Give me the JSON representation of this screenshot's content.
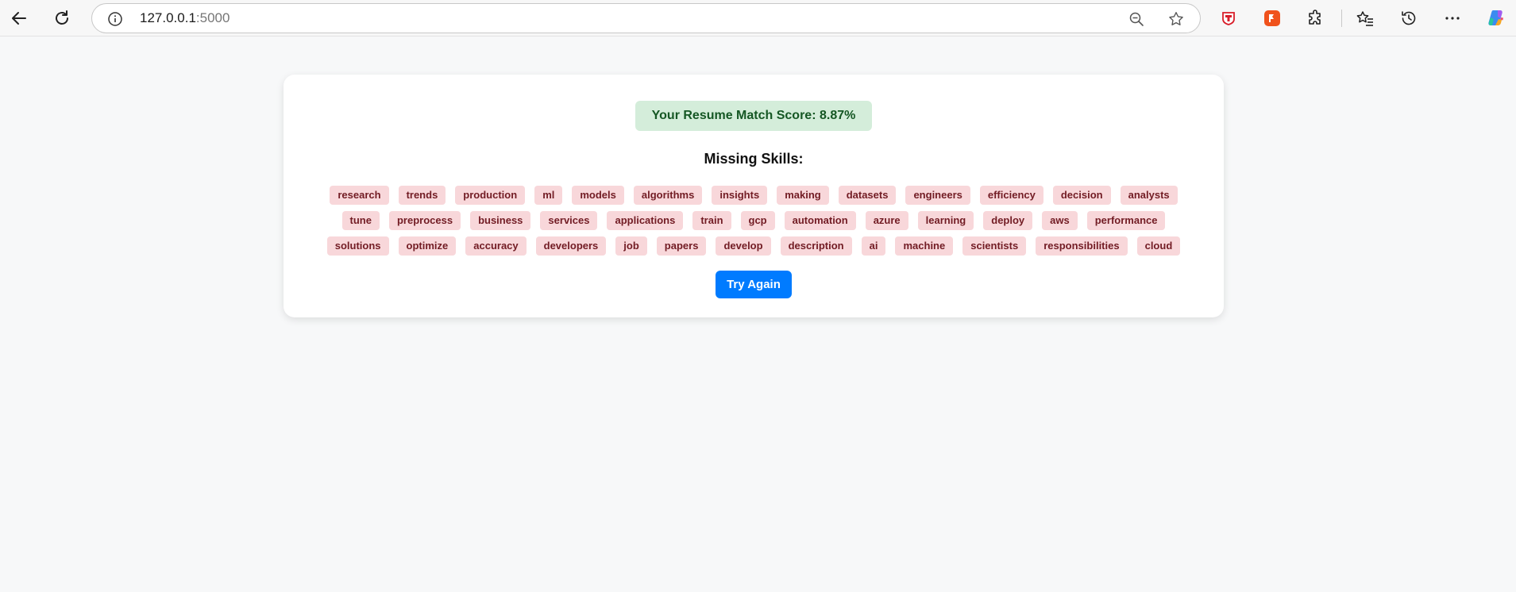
{
  "browser": {
    "url_host": "127.0.0.1",
    "url_port": ":5000",
    "icons": {
      "back": "back-arrow-icon",
      "reload": "reload-icon",
      "site_info": "info-icon",
      "zoom": "zoom-out-icon",
      "favorite": "star-icon",
      "extension_red": "shield-extension-icon",
      "extension_orange": "orange-extension-icon",
      "extensions": "puzzle-icon",
      "favorites": "favorites-icon",
      "history": "history-icon",
      "more": "more-icon",
      "copilot": "copilot-icon"
    },
    "colors": {
      "extension_red": "#d81e2a",
      "extension_orange": "#f0521c"
    }
  },
  "result": {
    "score_label": "Your Resume Match Score: 8.87%",
    "missing_title": "Missing Skills:",
    "missing_skills": [
      "research",
      "trends",
      "production",
      "ml",
      "models",
      "algorithms",
      "insights",
      "making",
      "datasets",
      "engineers",
      "efficiency",
      "decision",
      "analysts",
      "tune",
      "preprocess",
      "business",
      "services",
      "applications",
      "train",
      "gcp",
      "automation",
      "azure",
      "learning",
      "deploy",
      "aws",
      "performance",
      "solutions",
      "optimize",
      "accuracy",
      "developers",
      "job",
      "papers",
      "develop",
      "description",
      "ai",
      "machine",
      "scientists",
      "responsibilities",
      "cloud"
    ],
    "try_again_label": "Try Again",
    "colors": {
      "score_bg": "#d4edda",
      "score_text": "#155724",
      "skill_bg": "#f8d7da",
      "skill_text": "#721c24",
      "button_bg": "#007bff"
    }
  }
}
